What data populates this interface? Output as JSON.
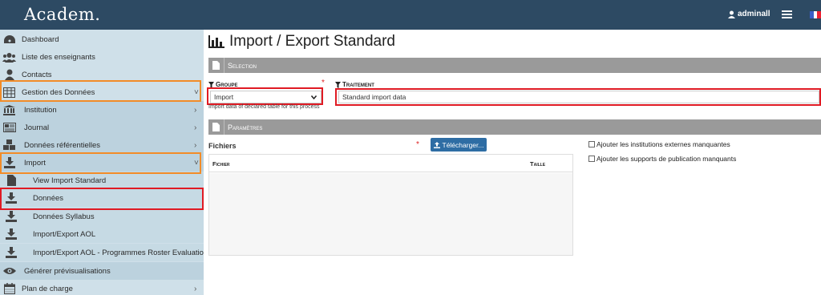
{
  "app": {
    "logo": "Academ."
  },
  "topbar": {
    "user": "adminall"
  },
  "sidebar": {
    "items": [
      {
        "label": "Dashboard",
        "icon": "dashboard-icon"
      },
      {
        "label": "Liste des enseignants",
        "icon": "users-icon"
      },
      {
        "label": "Contacts",
        "icon": "user-icon"
      },
      {
        "label": "Gestion des Données",
        "icon": "table-icon",
        "chevron": "˅"
      },
      {
        "label": "Institution",
        "icon": "institution-icon",
        "chevron": "›"
      },
      {
        "label": "Journal",
        "icon": "newspaper-icon",
        "chevron": "›"
      },
      {
        "label": "Données référentielles",
        "icon": "cubes-icon",
        "chevron": "›"
      },
      {
        "label": "Import",
        "icon": "download-icon",
        "chevron": "˅"
      },
      {
        "label": "View Import Standard",
        "icon": "file-icon"
      },
      {
        "label": "Données",
        "icon": "download-icon"
      },
      {
        "label": "Données Syllabus",
        "icon": "download-icon"
      },
      {
        "label": "Import/Export AOL",
        "icon": "download-icon"
      },
      {
        "label": "Import/Export AOL - Programmes Roster Evaluations",
        "icon": "download-icon"
      },
      {
        "label": "Générer prévisualisations",
        "icon": "eye-icon"
      },
      {
        "label": "Plan de charge",
        "icon": "calendar-icon",
        "chevron": "›"
      }
    ]
  },
  "main": {
    "title": "Import / Export Standard",
    "selection": {
      "header": "Selection",
      "groupe_label": "Groupe",
      "groupe_value": "Import",
      "groupe_hint": "Import data of declared table for this process",
      "traitement_label": "Traitement",
      "traitement_value": "Standard import data",
      "required_mark": "*"
    },
    "parametres": {
      "header": "Paramètres",
      "fichiers_label": "Fichiers",
      "upload_button": "Télécharger...",
      "required_mark": "*",
      "columns": [
        "Fichier",
        "Taille"
      ],
      "checkbox1": "Ajouter les institutions externes manquantes",
      "checkbox2": "Ajouter les supports de publication manquants"
    }
  },
  "colors": {
    "topbar": "#2d4a63",
    "sidebar": "#cfe0e9",
    "section": "#9a9a9a",
    "button": "#2e6da4",
    "highlight_orange": "#f28c28",
    "highlight_red": "#e01b24"
  }
}
